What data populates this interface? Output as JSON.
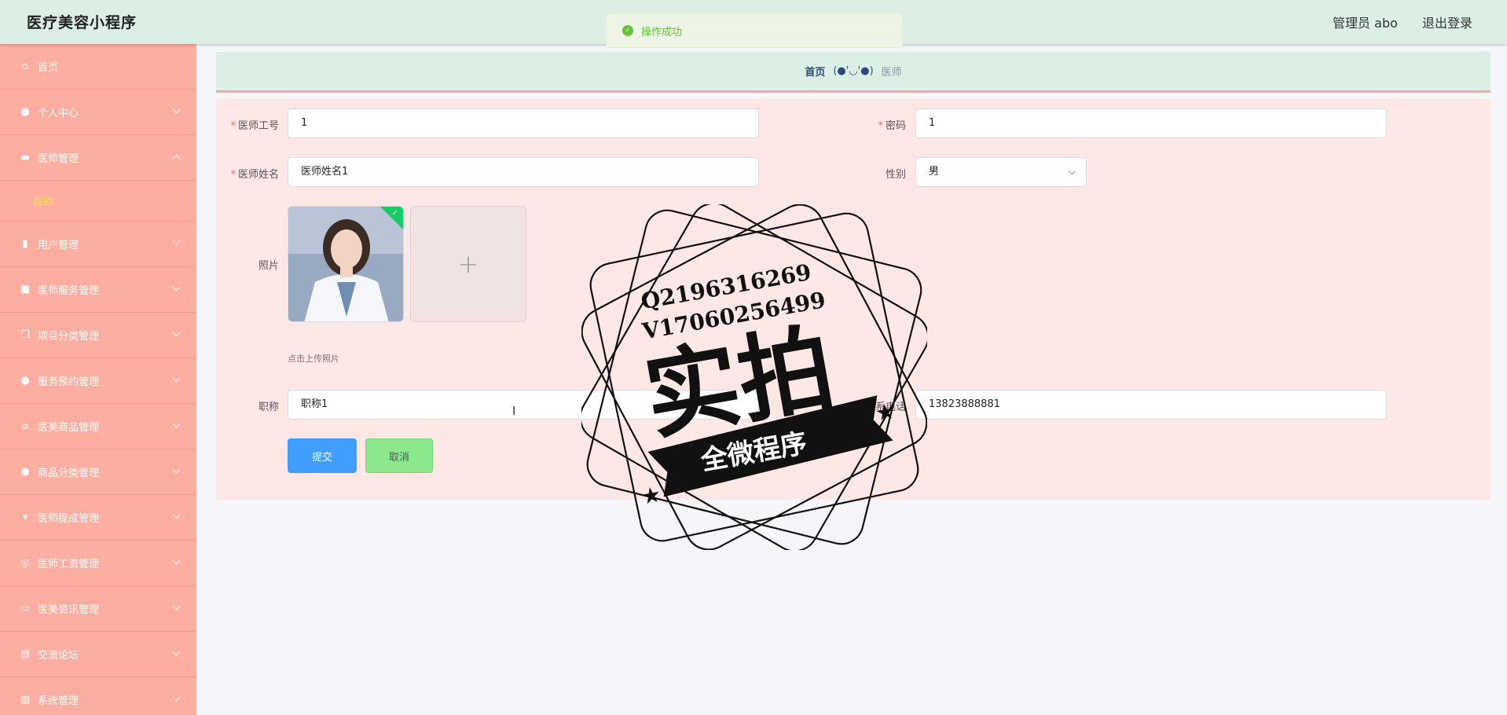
{
  "header": {
    "app_title": "医疗美容小程序",
    "user_label": "管理员 abo",
    "logout_label": "退出登录"
  },
  "toast": {
    "message": "操作成功"
  },
  "sidebar": {
    "items": [
      {
        "label": "首页",
        "icon": "home-icon"
      },
      {
        "label": "个人中心",
        "icon": "user-icon"
      },
      {
        "label": "医师管理",
        "icon": "ticket-icon",
        "expanded": true
      },
      {
        "label": "医师",
        "submenu": true
      },
      {
        "label": "用户管理",
        "icon": "book-icon"
      },
      {
        "label": "医师服务管理",
        "icon": "briefcase-icon"
      },
      {
        "label": "项目分类管理",
        "icon": "copy-icon"
      },
      {
        "label": "服务预约管理",
        "icon": "user-icon"
      },
      {
        "label": "医美商品管理",
        "icon": "bell-off-icon"
      },
      {
        "label": "商品分类管理",
        "icon": "user-icon"
      },
      {
        "label": "医师提成管理",
        "icon": "flag-icon"
      },
      {
        "label": "医师工资管理",
        "icon": "target-icon"
      },
      {
        "label": "医美资讯管理",
        "icon": "news-icon"
      },
      {
        "label": "交流论坛",
        "icon": "clipboard-icon"
      },
      {
        "label": "系统管理",
        "icon": "chart-icon"
      }
    ]
  },
  "breadcrumb": {
    "home": "首页",
    "emoticon": "(●'◡'●)",
    "current": "医师"
  },
  "form": {
    "doctor_id": {
      "label": "医师工号",
      "value": "1",
      "required": true
    },
    "password": {
      "label": "密码",
      "value": "1",
      "required": true
    },
    "doctor_name": {
      "label": "医师姓名",
      "value": "医师姓名1",
      "required": true
    },
    "gender": {
      "label": "性别",
      "value": "男"
    },
    "photo": {
      "label": "照片",
      "hint": "点击上传照片"
    },
    "title": {
      "label": "职称",
      "value": "职称1"
    },
    "phone": {
      "label": "联系电话",
      "value": "13823888881"
    },
    "submit_label": "提交",
    "cancel_label": "取消"
  },
  "watermark": {
    "line1": "Q2196316269",
    "line2": "V17060256499",
    "main": "实拍",
    "banner": "全微程序"
  },
  "colors": {
    "topbar": "#dcefe4",
    "sidebar": "#fdaea1",
    "panel": "#fde8e6",
    "primary": "#409eff",
    "cancel": "#8be88e",
    "submenu_active": "#ffe14a",
    "success": "#67c23a"
  }
}
